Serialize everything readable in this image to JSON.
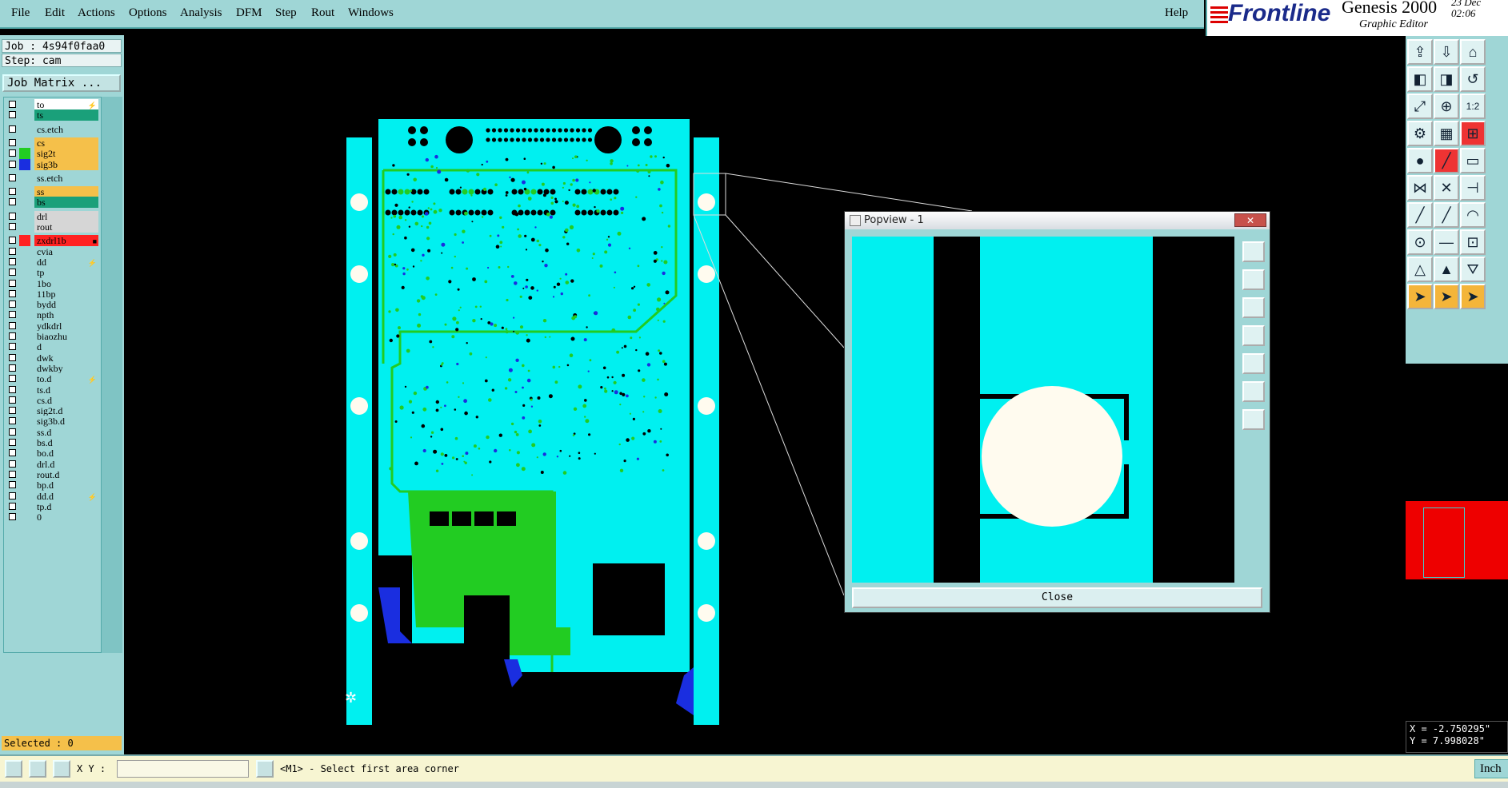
{
  "menu": {
    "items": [
      "File",
      "Edit",
      "Actions",
      "Options",
      "Analysis",
      "DFM",
      "Step",
      "Rout",
      "Windows"
    ],
    "help": "Help"
  },
  "brand": {
    "logo": "Frontline",
    "product": "Genesis 2000",
    "subtitle": "Graphic Editor",
    "date": "23  Dec",
    "time": "02:06"
  },
  "job": {
    "job_line": "Job : 4s94f0faa0",
    "step_line": "Step: cam",
    "matrix_button": "Job Matrix ..."
  },
  "colors": {
    "panel": "#9fd6d6",
    "pcb": "#00f0f0",
    "trace_green": "#22cc22",
    "board_black": "#000000",
    "pad_white": "#fffbef",
    "highlight_orange": "#f5c04a",
    "teal_layer": "#1aa07a"
  },
  "layers": [
    {
      "name": "to",
      "bg": "#ffffff",
      "color": "",
      "flag": "⚡"
    },
    {
      "name": "ts",
      "bg": "#1aa07a",
      "color": "",
      "flag": ""
    },
    {
      "name": "cs.etch",
      "bg": "#9fd6d6",
      "color": "",
      "flag": ""
    },
    {
      "name": "cs",
      "bg": "#f5c04a",
      "color": "",
      "flag": ""
    },
    {
      "name": "sig2t",
      "bg": "#f5c04a",
      "color": "#22cc22",
      "flag": ""
    },
    {
      "name": "sig3b",
      "bg": "#f5c04a",
      "color": "#1a2ee0",
      "flag": ""
    },
    {
      "name": "ss.etch",
      "bg": "#9fd6d6",
      "color": "",
      "flag": ""
    },
    {
      "name": "ss",
      "bg": "#f5c04a",
      "color": "",
      "flag": ""
    },
    {
      "name": "bs",
      "bg": "#1aa07a",
      "color": "",
      "flag": ""
    },
    {
      "name": "drl",
      "bg": "#d6d6d6",
      "color": "",
      "flag": ""
    },
    {
      "name": "rout",
      "bg": "#d6d6d6",
      "color": "",
      "flag": ""
    },
    {
      "name": "zxdrl1b",
      "bg": "#ff2222",
      "color": "#ff2222",
      "flag": "■"
    },
    {
      "name": "cvia",
      "bg": "#9fd6d6",
      "color": "",
      "flag": ""
    },
    {
      "name": "dd",
      "bg": "#9fd6d6",
      "color": "",
      "flag": "⚡"
    },
    {
      "name": "tp",
      "bg": "#9fd6d6",
      "color": "",
      "flag": ""
    },
    {
      "name": "1bo",
      "bg": "#9fd6d6",
      "color": "",
      "flag": ""
    },
    {
      "name": "11bp",
      "bg": "#9fd6d6",
      "color": "",
      "flag": ""
    },
    {
      "name": "bydd",
      "bg": "#9fd6d6",
      "color": "",
      "flag": ""
    },
    {
      "name": "npth",
      "bg": "#9fd6d6",
      "color": "",
      "flag": ""
    },
    {
      "name": "ydkdrl",
      "bg": "#9fd6d6",
      "color": "",
      "flag": ""
    },
    {
      "name": "biaozhu",
      "bg": "#9fd6d6",
      "color": "",
      "flag": ""
    },
    {
      "name": "d",
      "bg": "#9fd6d6",
      "color": "",
      "flag": ""
    },
    {
      "name": "dwk",
      "bg": "#9fd6d6",
      "color": "",
      "flag": ""
    },
    {
      "name": "dwkby",
      "bg": "#9fd6d6",
      "color": "",
      "flag": ""
    },
    {
      "name": "to.d",
      "bg": "#9fd6d6",
      "color": "",
      "flag": "⚡"
    },
    {
      "name": "ts.d",
      "bg": "#9fd6d6",
      "color": "",
      "flag": ""
    },
    {
      "name": "cs.d",
      "bg": "#9fd6d6",
      "color": "",
      "flag": ""
    },
    {
      "name": "sig2t.d",
      "bg": "#9fd6d6",
      "color": "",
      "flag": ""
    },
    {
      "name": "sig3b.d",
      "bg": "#9fd6d6",
      "color": "",
      "flag": ""
    },
    {
      "name": "ss.d",
      "bg": "#9fd6d6",
      "color": "",
      "flag": ""
    },
    {
      "name": "bs.d",
      "bg": "#9fd6d6",
      "color": "",
      "flag": ""
    },
    {
      "name": "bo.d",
      "bg": "#9fd6d6",
      "color": "",
      "flag": ""
    },
    {
      "name": "drl.d",
      "bg": "#9fd6d6",
      "color": "",
      "flag": ""
    },
    {
      "name": "rout.d",
      "bg": "#9fd6d6",
      "color": "",
      "flag": ""
    },
    {
      "name": "bp.d",
      "bg": "#9fd6d6",
      "color": "",
      "flag": ""
    },
    {
      "name": "dd.d",
      "bg": "#9fd6d6",
      "color": "",
      "flag": "⚡"
    },
    {
      "name": "tp.d",
      "bg": "#9fd6d6",
      "color": "",
      "flag": ""
    },
    {
      "name": "0",
      "bg": "#9fd6d6",
      "color": "",
      "flag": ""
    }
  ],
  "selected": "Selected : 0",
  "status": {
    "xy_label": "X Y :",
    "xy_value": "",
    "message": "<M1> - Select first area corner",
    "units": "Inch"
  },
  "coords": {
    "x": "X = -2.750295\"",
    "y": "Y = 7.998028\""
  },
  "popview": {
    "title": "Popview - 1",
    "close_label": "Close",
    "close_x": "✕"
  },
  "tools": [
    {
      "icon": "export-icon",
      "glyph": "⇪",
      "style": ""
    },
    {
      "icon": "import-icon",
      "glyph": "⇩",
      "style": ""
    },
    {
      "icon": "home-icon",
      "glyph": "⌂",
      "style": ""
    },
    {
      "icon": "zoom-left-icon",
      "glyph": "◧",
      "style": ""
    },
    {
      "icon": "zoom-right-icon",
      "glyph": "◨",
      "style": ""
    },
    {
      "icon": "undo-view-icon",
      "glyph": "↺",
      "style": ""
    },
    {
      "icon": "fit-all-icon",
      "glyph": "⤢",
      "style": ""
    },
    {
      "icon": "fit-center-icon",
      "glyph": "⊕",
      "style": ""
    },
    {
      "icon": "one-to-two-icon",
      "glyph": "1:2",
      "style": ""
    },
    {
      "icon": "settings-icon",
      "glyph": "⚙",
      "style": ""
    },
    {
      "icon": "grid-icon",
      "glyph": "▦",
      "style": ""
    },
    {
      "icon": "snap-icon",
      "glyph": "⊞",
      "style": "red"
    },
    {
      "icon": "pad-icon",
      "glyph": "●",
      "style": ""
    },
    {
      "icon": "line-add-icon",
      "glyph": "╱",
      "style": "red"
    },
    {
      "icon": "ruler-icon",
      "glyph": "▭",
      "style": ""
    },
    {
      "icon": "net-icon",
      "glyph": "⋈",
      "style": ""
    },
    {
      "icon": "cross-icon",
      "glyph": "✕",
      "style": ""
    },
    {
      "icon": "align-icon",
      "glyph": "⊣",
      "style": ""
    },
    {
      "icon": "draw-line-icon",
      "glyph": "╱",
      "style": ""
    },
    {
      "icon": "draw-line2-icon",
      "glyph": "╱",
      "style": ""
    },
    {
      "icon": "arc-icon",
      "glyph": "◠",
      "style": ""
    },
    {
      "icon": "move-pad-icon",
      "glyph": "⊙",
      "style": ""
    },
    {
      "icon": "minus-icon",
      "glyph": "—",
      "style": ""
    },
    {
      "icon": "measure-icon",
      "glyph": "⊡",
      "style": ""
    },
    {
      "icon": "tri1-icon",
      "glyph": "△",
      "style": ""
    },
    {
      "icon": "tri2-icon",
      "glyph": "▲",
      "style": ""
    },
    {
      "icon": "tri3-icon",
      "glyph": "⛛",
      "style": ""
    },
    {
      "icon": "pointer1-icon",
      "glyph": "➤",
      "style": "org"
    },
    {
      "icon": "pointer2-icon",
      "glyph": "➤",
      "style": "org"
    },
    {
      "icon": "pointer3-icon",
      "glyph": "➤",
      "style": "org"
    }
  ],
  "popview_tools": [
    "copy-icon",
    "up-icon",
    "down-icon",
    "left-icon",
    "right-icon",
    "fit-icon",
    "center-icon"
  ]
}
